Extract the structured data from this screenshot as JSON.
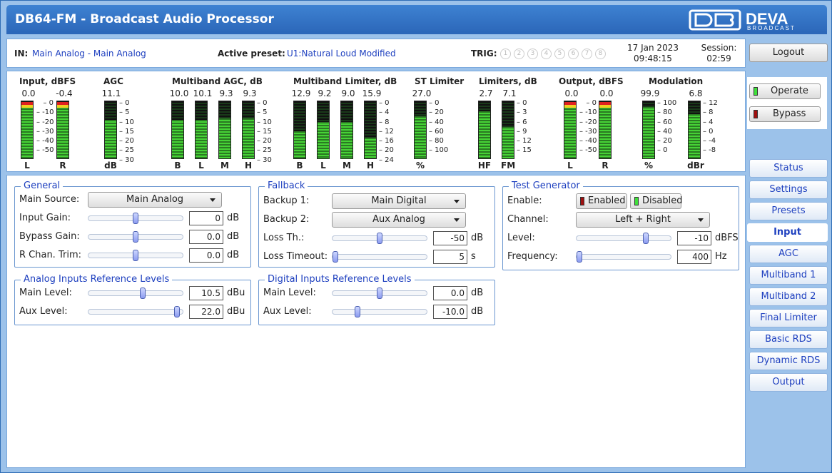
{
  "app": {
    "title": "DB64-FM - Broadcast Audio Processor",
    "logo_text": "DEVA",
    "logo_sub": "BROADCAST"
  },
  "info": {
    "in_label": "IN:",
    "in_value": "Main Analog - Main Analog",
    "preset_label": "Active preset:",
    "preset_value": "U1:Natural Loud Modified",
    "trig_label": "TRIG:",
    "trig": [
      "1",
      "2",
      "3",
      "4",
      "5",
      "6",
      "7",
      "8"
    ],
    "date": "17 Jan 2023",
    "time": "09:48:15",
    "session_label": "Session:",
    "session_value": "02:59"
  },
  "meters": {
    "input": {
      "title": "Input, dBFS",
      "values": [
        "0.0",
        "-0.4"
      ],
      "labels": [
        "L",
        "R"
      ],
      "scale": [
        "0",
        "-10",
        "-20",
        "-30",
        "-40",
        "-50"
      ],
      "levels": [
        0.98,
        0.97
      ]
    },
    "agc": {
      "title": "AGC",
      "values": [
        "11.1"
      ],
      "labels": [
        "dB"
      ],
      "scale": [
        "0",
        "5",
        "10",
        "15",
        "20",
        "25",
        "30"
      ],
      "levels": [
        0.68
      ]
    },
    "mb_agc": {
      "title": "Multiband AGC, dB",
      "values": [
        "10.0",
        "10.1",
        "9.3",
        "9.3"
      ],
      "labels": [
        "B",
        "L",
        "M",
        "H"
      ],
      "scale": [
        "0",
        "5",
        "10",
        "15",
        "20",
        "25",
        "30"
      ],
      "levels": [
        0.68,
        0.68,
        0.7,
        0.7
      ]
    },
    "mb_lim": {
      "title": "Multiband Limiter, dB",
      "values": [
        "12.9",
        "9.2",
        "9.0",
        "15.9"
      ],
      "labels": [
        "B",
        "L",
        "M",
        "H"
      ],
      "scale": [
        "0",
        "4",
        "8",
        "12",
        "16",
        "20",
        "24"
      ],
      "levels": [
        0.48,
        0.64,
        0.64,
        0.36
      ]
    },
    "st_lim": {
      "title": "ST Limiter",
      "values": [
        "27.0"
      ],
      "labels": [
        "%"
      ],
      "scale": [
        "0",
        "20",
        "40",
        "60",
        "80",
        "100"
      ],
      "levels": [
        0.74
      ]
    },
    "limiters": {
      "title": "Limiters, dB",
      "values": [
        "2.7",
        "7.1"
      ],
      "labels": [
        "HF",
        "FM"
      ],
      "scale": [
        "0",
        "3",
        "6",
        "9",
        "12",
        "15"
      ],
      "levels": [
        0.82,
        0.55
      ]
    },
    "output": {
      "title": "Output, dBFS",
      "values": [
        "0.0",
        "0.0"
      ],
      "labels": [
        "L",
        "R"
      ],
      "scale": [
        "0",
        "-10",
        "-20",
        "-30",
        "-40",
        "-50"
      ],
      "levels": [
        0.98,
        0.98
      ]
    },
    "modulation": {
      "title": "Modulation",
      "values": [
        "99.9",
        "6.8"
      ],
      "labels": [
        "%",
        "dBr"
      ],
      "scale_a": [
        "100",
        "80",
        "60",
        "40",
        "20",
        "0"
      ],
      "scale_b": [
        "12",
        "8",
        "4",
        "0",
        "-4",
        "-8"
      ],
      "levels": [
        0.9,
        0.78
      ]
    }
  },
  "general": {
    "legend": "General",
    "main_source_label": "Main Source:",
    "main_source": "Main Analog",
    "input_gain_label": "Input Gain:",
    "input_gain": "0",
    "input_gain_level": 0.5,
    "bypass_gain_label": "Bypass Gain:",
    "bypass_gain": "0.0",
    "bypass_gain_level": 0.5,
    "rtrim_label": "R Chan. Trim:",
    "rtrim": "0.0",
    "rtrim_level": 0.5,
    "unit": "dB"
  },
  "fallback": {
    "legend": "Fallback",
    "backup1_label": "Backup 1:",
    "backup1": "Main Digital",
    "backup2_label": "Backup 2:",
    "backup2": "Aux Analog",
    "loss_th_label": "Loss Th.:",
    "loss_th": "-50",
    "loss_th_unit": "dB",
    "loss_th_level": 0.5,
    "loss_to_label": "Loss Timeout:",
    "loss_to": "5",
    "loss_to_unit": "s",
    "loss_to_level": 0.0
  },
  "testgen": {
    "legend": "Test Generator",
    "enable_label": "Enable:",
    "enabled": "Enabled",
    "disabled": "Disabled",
    "channel_label": "Channel:",
    "channel": "Left + Right",
    "level_label": "Level:",
    "level": "-10",
    "level_unit": "dBFS",
    "level_level": 0.75,
    "freq_label": "Frequency:",
    "freq": "400",
    "freq_unit": "Hz",
    "freq_level": 0.0
  },
  "analog_ref": {
    "legend": "Analog Inputs Reference Levels",
    "main_label": "Main Level:",
    "main": "10.5",
    "main_level": 0.58,
    "aux_label": "Aux Level:",
    "aux": "22.0",
    "aux_level": 0.97,
    "unit": "dBu"
  },
  "digital_ref": {
    "legend": "Digital Inputs Reference Levels",
    "main_label": "Main Level:",
    "main": "0.0",
    "main_level": 0.5,
    "aux_label": "Aux Level:",
    "aux": "-10.0",
    "aux_level": 0.25,
    "unit": "dB"
  },
  "side": {
    "logout": "Logout",
    "operate": "Operate",
    "bypass": "Bypass",
    "nav": [
      "Status",
      "Settings",
      "Presets",
      "Input",
      "AGC",
      "Multiband 1",
      "Multiband 2",
      "Final Limiter",
      "Basic RDS",
      "Dynamic RDS",
      "Output"
    ],
    "active": "Input"
  },
  "colors": {
    "accent": "#1d3fbf",
    "header": "#2b66b8",
    "led_green": "#3ee03a",
    "led_red": "#a01010"
  }
}
